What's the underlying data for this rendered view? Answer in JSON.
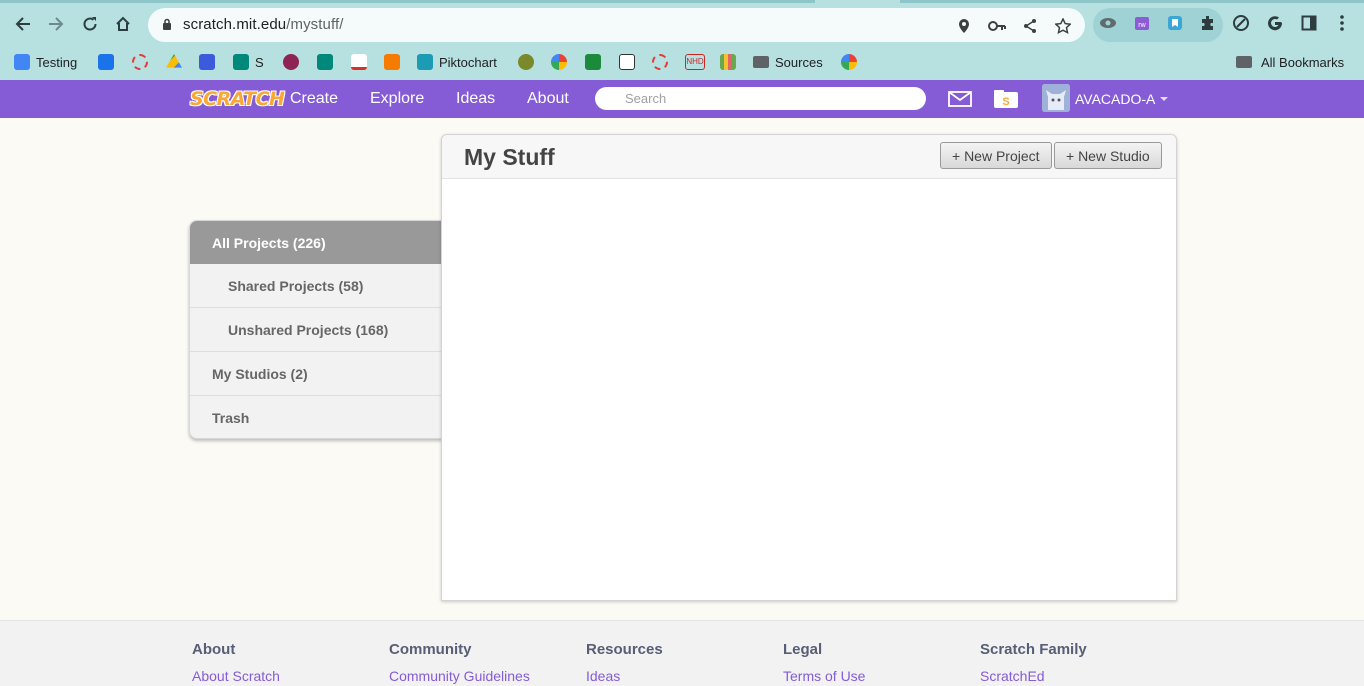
{
  "browser": {
    "url_domain": "scratch.mit.edu",
    "url_path": "/mystuff/",
    "bookmarks": [
      {
        "label": "Testing",
        "color": "#4285f4"
      },
      {
        "label": "",
        "color": "#1a73e8"
      },
      {
        "label": "",
        "color": "#e53935"
      },
      {
        "label": "",
        "color": "#34a853"
      },
      {
        "label": "",
        "color": "#3b5bdb"
      },
      {
        "label": "S",
        "color": "#00897b"
      },
      {
        "label": "",
        "color": "#8e2451"
      },
      {
        "label": "",
        "color": "#00897b"
      },
      {
        "label": "",
        "color": "#d93025"
      },
      {
        "label": "",
        "color": "#f57c00"
      },
      {
        "label": "Piktochart",
        "color": "#1c9bb5"
      },
      {
        "label": "",
        "color": "#7a8a2a"
      },
      {
        "label": "",
        "color": "#f4b400"
      },
      {
        "label": "",
        "color": "#1b8a3a"
      },
      {
        "label": "",
        "color": "#333333"
      },
      {
        "label": "",
        "color": "#e53935"
      },
      {
        "label": "NHD",
        "color": "#c62828"
      },
      {
        "label": "",
        "color": "#6aa84f"
      },
      {
        "label": "Sources",
        "color": "#5f6368"
      },
      {
        "label": "",
        "color": "#4285f4"
      }
    ],
    "all_bookmarks_label": "All Bookmarks"
  },
  "nav": {
    "logo_text": "SCRATCH",
    "links": [
      "Create",
      "Explore",
      "Ideas",
      "About"
    ],
    "search_placeholder": "Search",
    "username": "AVACADO-A"
  },
  "sidebar": {
    "items": [
      {
        "label": "All Projects (226)",
        "active": true
      },
      {
        "label": "Shared Projects (58)"
      },
      {
        "label": "Unshared Projects (168)"
      },
      {
        "label": "My Studios (2)"
      },
      {
        "label": "Trash"
      }
    ]
  },
  "main": {
    "title": "My Stuff",
    "new_project_label": "+ New Project",
    "new_studio_label": "+ New Studio"
  },
  "footer": {
    "columns": [
      {
        "heading": "About",
        "link": "About Scratch"
      },
      {
        "heading": "Community",
        "link": "Community Guidelines"
      },
      {
        "heading": "Resources",
        "link": "Ideas"
      },
      {
        "heading": "Legal",
        "link": "Terms of Use"
      },
      {
        "heading": "Scratch Family",
        "link": "ScratchEd"
      }
    ]
  },
  "colors": {
    "scratch_purple": "#855cd6",
    "chrome_teal": "#b7e0e0"
  }
}
